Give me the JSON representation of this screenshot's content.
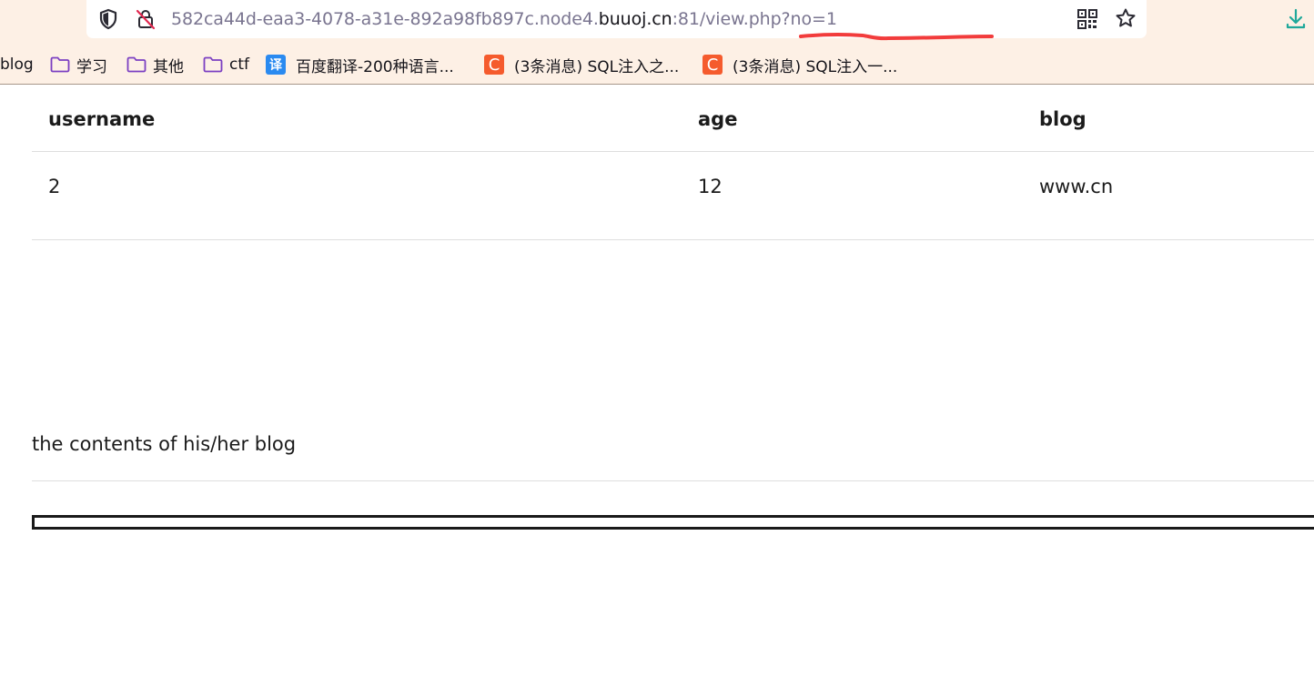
{
  "browser": {
    "url_prefix": "582ca44d-eaa3-4078-a31e-892a98fb897c.node4.",
    "url_domain": "buuoj.cn",
    "url_suffix": ":81/view.php?no=1",
    "annotation_color": "#f23c3c",
    "bookmarks": [
      {
        "label": "blog",
        "icon": "none"
      },
      {
        "label": "学习",
        "icon": "folder-icon"
      },
      {
        "label": "其他",
        "icon": "folder-icon"
      },
      {
        "label": "ctf",
        "icon": "folder-icon"
      },
      {
        "label": "百度翻译-200种语言...",
        "icon": "translate-icon",
        "badge": "译"
      },
      {
        "label": "(3条消息) SQL注入之...",
        "icon": "csdn-icon",
        "badge": "C"
      },
      {
        "label": "(3条消息) SQL注入一...",
        "icon": "csdn-icon",
        "badge": "C"
      }
    ]
  },
  "table": {
    "headers": [
      "username",
      "age",
      "blog"
    ],
    "rows": [
      [
        "2",
        "12",
        "www.cn"
      ]
    ]
  },
  "blog_section": {
    "text": "the contents of his/her blog"
  }
}
